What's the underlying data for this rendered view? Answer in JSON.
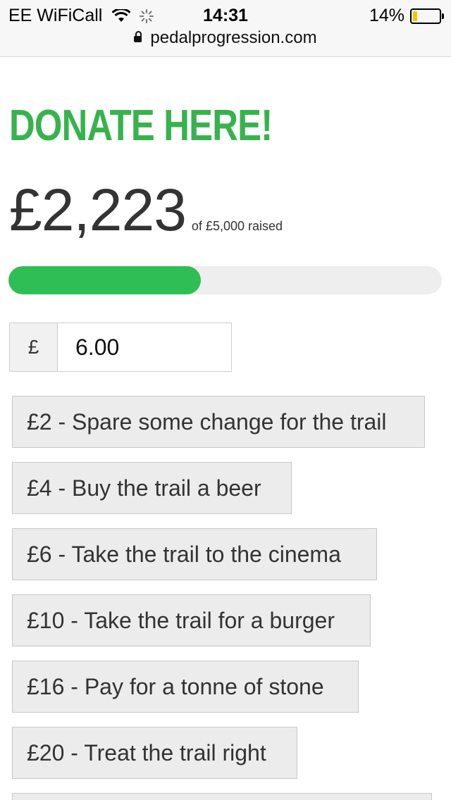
{
  "status_bar": {
    "carrier": "EE WiFiCall",
    "time": "14:31",
    "battery": "14%",
    "url": "pedalprogression.com"
  },
  "donate": {
    "title": "DONATE HERE!",
    "raised_amount": "£2,223",
    "raised_suffix": "of £5,000 raised",
    "progress_fraction": 0.4446,
    "currency_symbol": "£",
    "amount_value": "6.00"
  },
  "options": [
    "£2 - Spare some change for the trail",
    "£4 - Buy the trail a beer",
    "£6 - Take the trail to the cinema",
    "£10 - Take the trail for a burger",
    "£16 - Pay for a tonne of stone",
    "£20 - Treat the trail right"
  ],
  "colors": {
    "accent": "#37b24d",
    "progress": "#2fbe55"
  },
  "icons": [
    "wifi-icon",
    "activity-spinner-icon",
    "battery-icon",
    "lock-icon"
  ]
}
